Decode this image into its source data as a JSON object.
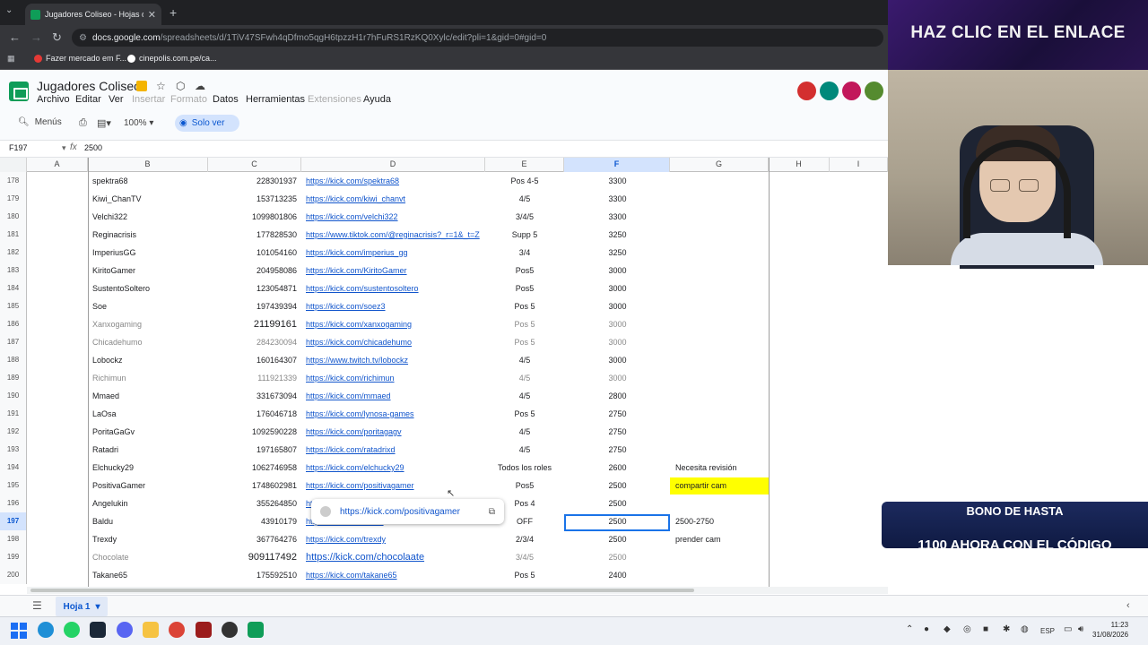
{
  "browser": {
    "tab_title": "Jugadores Coliseo - Hojas de cálculo",
    "url_host": "docs.google.com",
    "url_path": "/spreadsheets/d/1TiV47SFwh4qDfmo5qgH6tpzzH1r7hFuRS1RzKQ0Xylc/edit?pli=1&gid=0#gid=0",
    "bookmarks": [
      "Fazer mercado em F...",
      "cinepolis.com.pe/ca..."
    ]
  },
  "sheets": {
    "title": "Jugadores Coliseo",
    "menu": [
      "Archivo",
      "Editar",
      "Ver",
      "Insertar",
      "Formato",
      "Datos",
      "Herramientas",
      "Extensiones",
      "Ayuda"
    ],
    "menus_label": "Menús",
    "zoom": "100%",
    "view_mode": "Solo ver",
    "cell_ref": "F197",
    "formula_value": "2500",
    "columns": [
      "A",
      "B",
      "C",
      "D",
      "E",
      "F",
      "G",
      "H",
      "I"
    ],
    "selected_column": "F",
    "selected_row": "197",
    "rows": [
      {
        "n": "178",
        "name": "spektra68",
        "id": "228301937",
        "link": "https://kick.com/spektra68",
        "pos": "Pos 4-5",
        "val": "3300",
        "note": ""
      },
      {
        "n": "179",
        "name": "Kiwi_ChanTV",
        "id": "153713235",
        "link": "https://kick.com/kiwi_chanvt",
        "pos": "4/5",
        "val": "3300",
        "note": ""
      },
      {
        "n": "180",
        "name": "Velchi322",
        "id": "1099801806",
        "link": "https://kick.com/velchi322",
        "pos": "3/4/5",
        "val": "3300",
        "note": ""
      },
      {
        "n": "181",
        "name": "Reginacrisis",
        "id": "177828530",
        "link": "https://www.tiktok.com/@reginacrisis?_r=1&_t=Z",
        "pos": "Supp 5",
        "val": "3250",
        "note": ""
      },
      {
        "n": "182",
        "name": "ImperiusGG",
        "id": "101054160",
        "link": "https://kick.com/imperius_gg",
        "pos": "3/4",
        "val": "3250",
        "note": ""
      },
      {
        "n": "183",
        "name": "KiritoGamer",
        "id": "204958086",
        "link": "https://kick.com/KiritoGamer",
        "pos": "Pos5",
        "val": "3000",
        "note": ""
      },
      {
        "n": "184",
        "name": "SustentoSoltero",
        "id": "123054871",
        "link": "https://kick.com/sustentosoltero",
        "pos": "Pos5",
        "val": "3000",
        "note": ""
      },
      {
        "n": "185",
        "name": "Soe",
        "id": "197439394",
        "link": "https://kick.com/soez3",
        "pos": "Pos 5",
        "val": "3000",
        "note": ""
      },
      {
        "n": "186",
        "name": "Xanxogaming",
        "id": "21199161",
        "link": "https://kick.com/xanxogaming",
        "pos": "Pos 5",
        "val": "3000",
        "note": ""
      },
      {
        "n": "187",
        "name": "Chicadehumo",
        "id": "284230094",
        "link": "https://kick.com/chicadehumo",
        "pos": "Pos 5",
        "val": "3000",
        "note": ""
      },
      {
        "n": "188",
        "name": "Lobockz",
        "id": "160164307",
        "link": "https://www.twitch.tv/lobockz",
        "pos": "4/5",
        "val": "3000",
        "note": ""
      },
      {
        "n": "189",
        "name": "Richimun",
        "id": "111921339",
        "link": "https://kick.com/richimun",
        "pos": "4/5",
        "val": "3000",
        "note": ""
      },
      {
        "n": "190",
        "name": "Mmaed",
        "id": "331673094",
        "link": "https://kick.com/mmaed",
        "pos": "4/5",
        "val": "2800",
        "note": ""
      },
      {
        "n": "191",
        "name": "LaOsa",
        "id": "176046718",
        "link": "https://kick.com/lynosa-games",
        "pos": "Pos 5",
        "val": "2750",
        "note": ""
      },
      {
        "n": "192",
        "name": "PoritaGaGv",
        "id": "1092590228",
        "link": "https://kick.com/poritagagv",
        "pos": "4/5",
        "val": "2750",
        "note": ""
      },
      {
        "n": "193",
        "name": "Ratadri",
        "id": "197165807",
        "link": "https://kick.com/ratadrixd",
        "pos": "4/5",
        "val": "2750",
        "note": ""
      },
      {
        "n": "194",
        "name": "Elchucky29",
        "id": "1062746958",
        "link": "https://kick.com/elchucky29",
        "pos": "Todos los roles",
        "val": "2600",
        "note": "Necesita revisión"
      },
      {
        "n": "195",
        "name": "PositivaGamer",
        "id": "1748602981",
        "link": "https://kick.com/positivagamer",
        "pos": "Pos5",
        "val": "2500",
        "note": "compartir cam"
      },
      {
        "n": "196",
        "name": "Angelukin",
        "id": "355264850",
        "link": "https://kick.com/angelukin",
        "pos": "Pos 4",
        "val": "2500",
        "note": ""
      },
      {
        "n": "197",
        "name": "Baldu",
        "id": "43910179",
        "link": "https://kick.com/baldu",
        "pos": "OFF",
        "val": "2500",
        "note": "2500-2750"
      },
      {
        "n": "198",
        "name": "Trexdy",
        "id": "367764276",
        "link": "https://kick.com/trexdy",
        "pos": "2/3/4",
        "val": "2500",
        "note": "prender cam"
      },
      {
        "n": "199",
        "name": "Chocolate",
        "id": "909117492",
        "link": "https://kick.com/chocolaate",
        "pos": "3/4/5",
        "val": "2500",
        "note": ""
      },
      {
        "n": "200",
        "name": "Takane65",
        "id": "175592510",
        "link": "https://kick.com/takane65",
        "pos": "Pos 5",
        "val": "2400",
        "note": ""
      }
    ],
    "tooltip_link": "https://kick.com/positivagamer",
    "sheet_tab": "Hoja 1"
  },
  "stream": {
    "banner_top": "HAZ CLIC EN EL ENLACE",
    "bono_line1": "BONO DE HASTA",
    "bono_line2": "1100 AHORA CON EL CÓDIGO"
  },
  "taskbar": {
    "lang": "ESP",
    "time": "11:23",
    "date": "31/08/2026"
  },
  "colors": {
    "accent": "#0b57d0",
    "highlight": "#ffff00",
    "link": "#1155cc"
  }
}
